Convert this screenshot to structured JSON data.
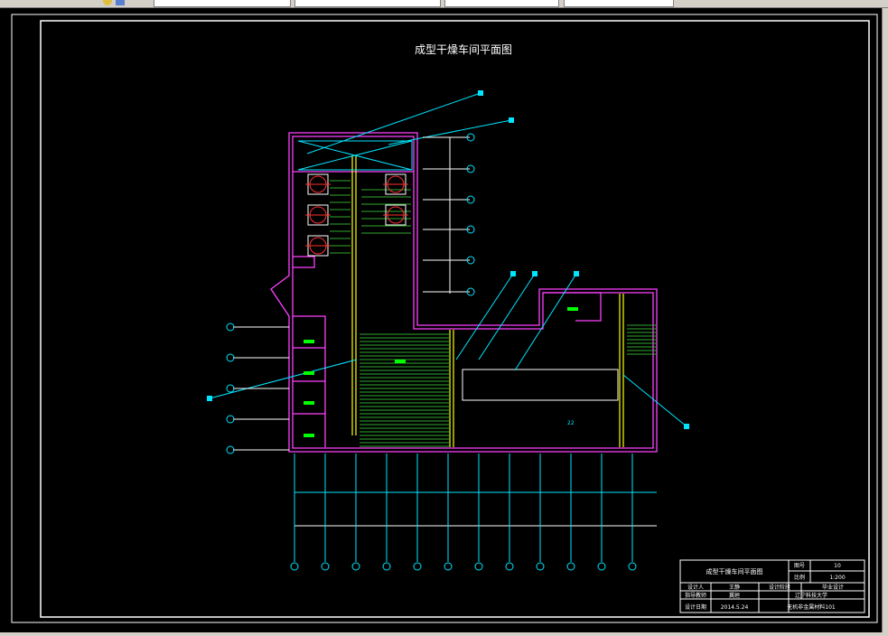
{
  "toolbar": {
    "layer_value": "",
    "linetype_value": "",
    "lineweight_value": "",
    "style_value": ""
  },
  "drawing": {
    "title": "成型干燥车间平面图",
    "dimension_label": "22"
  },
  "title_block": {
    "drawing_name": "成型干燥车间平面图",
    "sheet_no_label": "图号",
    "sheet_no": "10",
    "scale_label": "比例",
    "scale": "1:200",
    "designer_label": "设计人",
    "designer": "王静",
    "stage_label": "设计阶段",
    "stage": "毕业设计",
    "advisor_label": "指导教师",
    "advisor": "冀姮",
    "school": "辽宁科技大学",
    "date_label": "设计日期",
    "date": "2014.5.24",
    "class": "无机非金属材料101"
  },
  "colors": {
    "magenta": "#ff40ff",
    "cyan": "#00e5ff",
    "yellow": "#ffff00",
    "green": "#00ff00",
    "red": "#ff3030",
    "white": "#ffffff"
  }
}
